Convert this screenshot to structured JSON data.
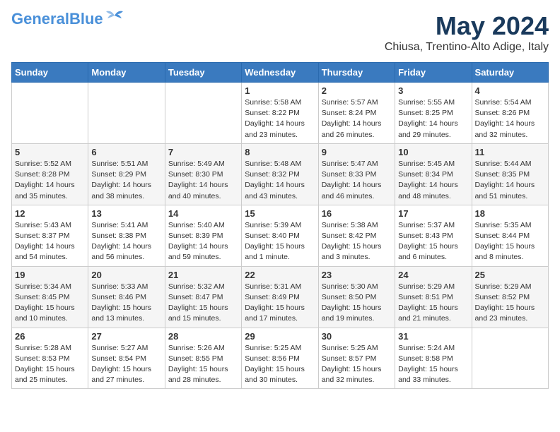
{
  "logo": {
    "part1": "General",
    "part2": "Blue"
  },
  "title": {
    "month_year": "May 2024",
    "location": "Chiusa, Trentino-Alto Adige, Italy"
  },
  "days_of_week": [
    "Sunday",
    "Monday",
    "Tuesday",
    "Wednesday",
    "Thursday",
    "Friday",
    "Saturday"
  ],
  "weeks": [
    [
      {
        "day": "",
        "info": ""
      },
      {
        "day": "",
        "info": ""
      },
      {
        "day": "",
        "info": ""
      },
      {
        "day": "1",
        "info": "Sunrise: 5:58 AM\nSunset: 8:22 PM\nDaylight: 14 hours\nand 23 minutes."
      },
      {
        "day": "2",
        "info": "Sunrise: 5:57 AM\nSunset: 8:24 PM\nDaylight: 14 hours\nand 26 minutes."
      },
      {
        "day": "3",
        "info": "Sunrise: 5:55 AM\nSunset: 8:25 PM\nDaylight: 14 hours\nand 29 minutes."
      },
      {
        "day": "4",
        "info": "Sunrise: 5:54 AM\nSunset: 8:26 PM\nDaylight: 14 hours\nand 32 minutes."
      }
    ],
    [
      {
        "day": "5",
        "info": "Sunrise: 5:52 AM\nSunset: 8:28 PM\nDaylight: 14 hours\nand 35 minutes."
      },
      {
        "day": "6",
        "info": "Sunrise: 5:51 AM\nSunset: 8:29 PM\nDaylight: 14 hours\nand 38 minutes."
      },
      {
        "day": "7",
        "info": "Sunrise: 5:49 AM\nSunset: 8:30 PM\nDaylight: 14 hours\nand 40 minutes."
      },
      {
        "day": "8",
        "info": "Sunrise: 5:48 AM\nSunset: 8:32 PM\nDaylight: 14 hours\nand 43 minutes."
      },
      {
        "day": "9",
        "info": "Sunrise: 5:47 AM\nSunset: 8:33 PM\nDaylight: 14 hours\nand 46 minutes."
      },
      {
        "day": "10",
        "info": "Sunrise: 5:45 AM\nSunset: 8:34 PM\nDaylight: 14 hours\nand 48 minutes."
      },
      {
        "day": "11",
        "info": "Sunrise: 5:44 AM\nSunset: 8:35 PM\nDaylight: 14 hours\nand 51 minutes."
      }
    ],
    [
      {
        "day": "12",
        "info": "Sunrise: 5:43 AM\nSunset: 8:37 PM\nDaylight: 14 hours\nand 54 minutes."
      },
      {
        "day": "13",
        "info": "Sunrise: 5:41 AM\nSunset: 8:38 PM\nDaylight: 14 hours\nand 56 minutes."
      },
      {
        "day": "14",
        "info": "Sunrise: 5:40 AM\nSunset: 8:39 PM\nDaylight: 14 hours\nand 59 minutes."
      },
      {
        "day": "15",
        "info": "Sunrise: 5:39 AM\nSunset: 8:40 PM\nDaylight: 15 hours\nand 1 minute."
      },
      {
        "day": "16",
        "info": "Sunrise: 5:38 AM\nSunset: 8:42 PM\nDaylight: 15 hours\nand 3 minutes."
      },
      {
        "day": "17",
        "info": "Sunrise: 5:37 AM\nSunset: 8:43 PM\nDaylight: 15 hours\nand 6 minutes."
      },
      {
        "day": "18",
        "info": "Sunrise: 5:35 AM\nSunset: 8:44 PM\nDaylight: 15 hours\nand 8 minutes."
      }
    ],
    [
      {
        "day": "19",
        "info": "Sunrise: 5:34 AM\nSunset: 8:45 PM\nDaylight: 15 hours\nand 10 minutes."
      },
      {
        "day": "20",
        "info": "Sunrise: 5:33 AM\nSunset: 8:46 PM\nDaylight: 15 hours\nand 13 minutes."
      },
      {
        "day": "21",
        "info": "Sunrise: 5:32 AM\nSunset: 8:47 PM\nDaylight: 15 hours\nand 15 minutes."
      },
      {
        "day": "22",
        "info": "Sunrise: 5:31 AM\nSunset: 8:49 PM\nDaylight: 15 hours\nand 17 minutes."
      },
      {
        "day": "23",
        "info": "Sunrise: 5:30 AM\nSunset: 8:50 PM\nDaylight: 15 hours\nand 19 minutes."
      },
      {
        "day": "24",
        "info": "Sunrise: 5:29 AM\nSunset: 8:51 PM\nDaylight: 15 hours\nand 21 minutes."
      },
      {
        "day": "25",
        "info": "Sunrise: 5:29 AM\nSunset: 8:52 PM\nDaylight: 15 hours\nand 23 minutes."
      }
    ],
    [
      {
        "day": "26",
        "info": "Sunrise: 5:28 AM\nSunset: 8:53 PM\nDaylight: 15 hours\nand 25 minutes."
      },
      {
        "day": "27",
        "info": "Sunrise: 5:27 AM\nSunset: 8:54 PM\nDaylight: 15 hours\nand 27 minutes."
      },
      {
        "day": "28",
        "info": "Sunrise: 5:26 AM\nSunset: 8:55 PM\nDaylight: 15 hours\nand 28 minutes."
      },
      {
        "day": "29",
        "info": "Sunrise: 5:25 AM\nSunset: 8:56 PM\nDaylight: 15 hours\nand 30 minutes."
      },
      {
        "day": "30",
        "info": "Sunrise: 5:25 AM\nSunset: 8:57 PM\nDaylight: 15 hours\nand 32 minutes."
      },
      {
        "day": "31",
        "info": "Sunrise: 5:24 AM\nSunset: 8:58 PM\nDaylight: 15 hours\nand 33 minutes."
      },
      {
        "day": "",
        "info": ""
      }
    ]
  ]
}
